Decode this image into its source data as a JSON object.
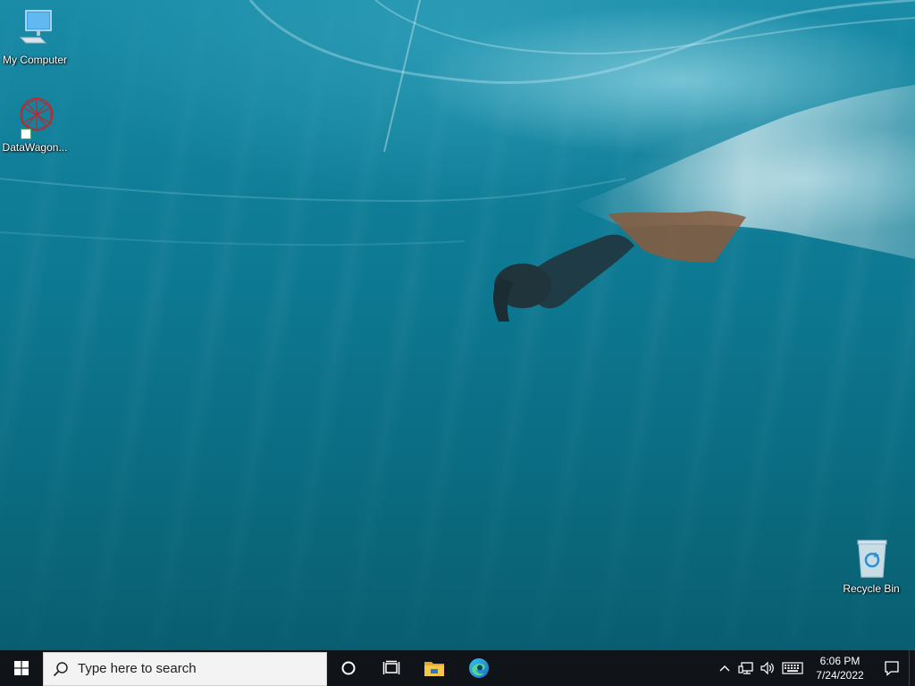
{
  "desktop": {
    "icons": [
      {
        "label": "My Computer",
        "icon": "monitor-icon"
      },
      {
        "label": "DataWagon...",
        "icon": "datawagon-icon"
      },
      {
        "label": "Recycle Bin",
        "icon": "recycle-bin-icon"
      }
    ]
  },
  "taskbar": {
    "start_icon": "windows-logo-icon",
    "search": {
      "placeholder": "Type here to search",
      "icon": "search-icon"
    },
    "pinned": [
      {
        "name": "cortana",
        "icon": "cortana-circle-icon"
      },
      {
        "name": "task-view",
        "icon": "task-view-icon"
      },
      {
        "name": "file-explorer",
        "icon": "folder-icon"
      },
      {
        "name": "edge",
        "icon": "edge-browser-icon"
      }
    ],
    "tray": {
      "icons": [
        "chevron-up-icon",
        "network-icon",
        "volume-icon",
        "keyboard-icon"
      ],
      "time": "6:06 PM",
      "date": "7/24/2022",
      "notification_icon": "notification-icon"
    }
  },
  "colors": {
    "taskbar": "#101418",
    "water_top": "#1a8ca8",
    "water_bottom": "#095d70",
    "edge_accent": "#1b9de2",
    "folder": "#f5c84c"
  }
}
